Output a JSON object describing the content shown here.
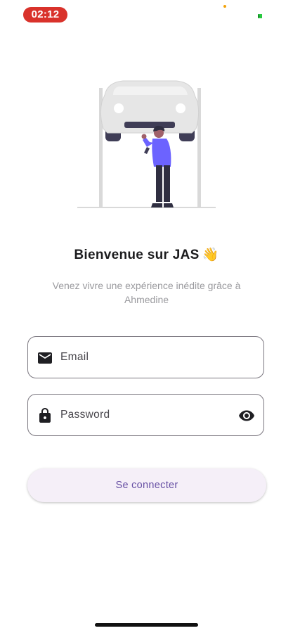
{
  "status_bar": {
    "time": "02:12",
    "time_pill_color": "#d9322b"
  },
  "illustration": {
    "icon": "mechanic-under-car-illustration"
  },
  "welcome": {
    "title": "Bienvenue sur JAS",
    "title_emoji": "👋",
    "subtitle": "Venez vivre une expérience inédite grâce à Ahmedine"
  },
  "form": {
    "email": {
      "placeholder": "Email",
      "value": "",
      "icon": "mail-icon"
    },
    "password": {
      "placeholder": "Password",
      "value": "",
      "icon": "lock-icon",
      "toggle_icon": "eye-icon"
    }
  },
  "login_button": {
    "label": "Se connecter",
    "color": "#6750a4"
  }
}
